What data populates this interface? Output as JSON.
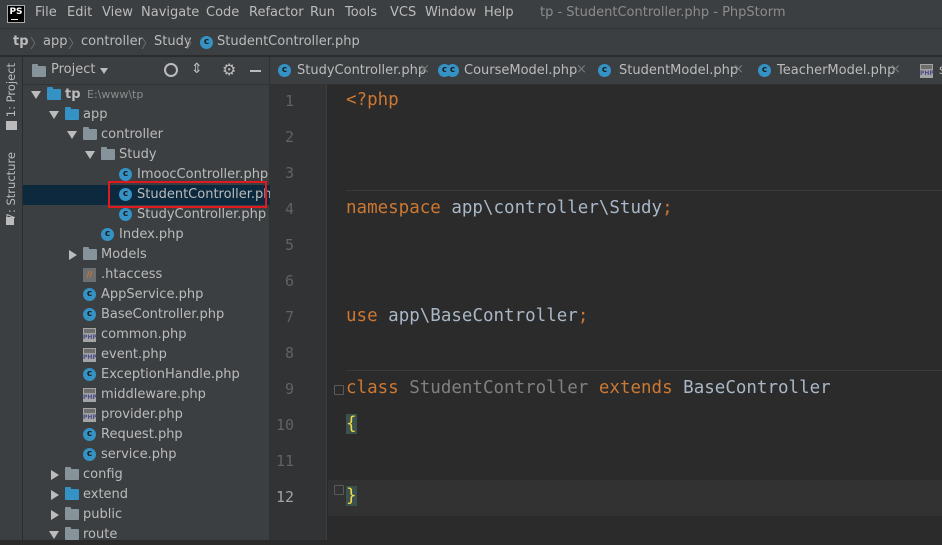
{
  "window": {
    "title": "tp - StudentController.php - PhpStorm",
    "logo_text": "PS"
  },
  "menu": [
    "File",
    "Edit",
    "View",
    "Navigate",
    "Code",
    "Refactor",
    "Run",
    "Tools",
    "VCS",
    "Window",
    "Help"
  ],
  "breadcrumbs": [
    "tp",
    "app",
    "controller",
    "Study",
    "StudentController.php"
  ],
  "sidestrip": {
    "project_tab": "1: Project",
    "structure_tab": "7: Structure"
  },
  "project_panel": {
    "title": "Project",
    "tree": [
      {
        "label": "tp",
        "extra": "E:\\www\\tp",
        "type": "folder-blue",
        "depth": 0,
        "expanded": true,
        "bold": true
      },
      {
        "label": "app",
        "type": "folder-blue",
        "depth": 1,
        "expanded": true
      },
      {
        "label": "controller",
        "type": "folder",
        "depth": 2,
        "expanded": true
      },
      {
        "label": "Study",
        "type": "folder",
        "depth": 3,
        "expanded": true
      },
      {
        "label": "ImoocController.php",
        "type": "class",
        "depth": 4
      },
      {
        "label": "StudentController.php",
        "type": "class",
        "depth": 4,
        "selected": true,
        "highlighted": true
      },
      {
        "label": "StudyController.php",
        "type": "class",
        "depth": 4
      },
      {
        "label": "Index.php",
        "type": "class",
        "depth": 3
      },
      {
        "label": "Models",
        "type": "folder",
        "depth": 2,
        "expanded": false
      },
      {
        "label": ".htaccess",
        "type": "htaccess",
        "depth": 2
      },
      {
        "label": "AppService.php",
        "type": "class",
        "depth": 2
      },
      {
        "label": "BaseController.php",
        "type": "class",
        "depth": 2
      },
      {
        "label": "common.php",
        "type": "php",
        "depth": 2
      },
      {
        "label": "event.php",
        "type": "php",
        "depth": 2
      },
      {
        "label": "ExceptionHandle.php",
        "type": "class",
        "depth": 2
      },
      {
        "label": "middleware.php",
        "type": "php",
        "depth": 2
      },
      {
        "label": "provider.php",
        "type": "php",
        "depth": 2
      },
      {
        "label": "Request.php",
        "type": "class",
        "depth": 2
      },
      {
        "label": "service.php",
        "type": "class",
        "depth": 2
      },
      {
        "label": "config",
        "type": "folder",
        "depth": 1,
        "expanded": false
      },
      {
        "label": "extend",
        "type": "folder-blue",
        "depth": 1,
        "expanded": false
      },
      {
        "label": "public",
        "type": "folder",
        "depth": 1,
        "expanded": false
      },
      {
        "label": "route",
        "type": "folder",
        "depth": 1,
        "expanded": true
      }
    ]
  },
  "tabs": [
    {
      "label": "StudyController.php"
    },
    {
      "label": "CourseModel.php"
    },
    {
      "label": "StudentModel.php"
    },
    {
      "label": "TeacherModel.php"
    },
    {
      "label": "s"
    }
  ],
  "editor": {
    "current_line": 12,
    "lines": [
      {
        "n": "1",
        "tokens": [
          [
            "kw",
            "<?php"
          ]
        ]
      },
      {
        "n": "2",
        "tokens": []
      },
      {
        "n": "3",
        "tokens": []
      },
      {
        "n": "4",
        "tokens": [
          [
            "kw",
            "namespace "
          ],
          [
            "txt",
            "app\\controller\\Study"
          ],
          [
            "kw",
            ";"
          ]
        ]
      },
      {
        "n": "5",
        "tokens": []
      },
      {
        "n": "6",
        "tokens": []
      },
      {
        "n": "7",
        "tokens": [
          [
            "kw",
            "use "
          ],
          [
            "txt",
            "app\\BaseController"
          ],
          [
            "kw",
            ";"
          ]
        ]
      },
      {
        "n": "8",
        "tokens": []
      },
      {
        "n": "9",
        "tokens": [
          [
            "kw",
            "class "
          ],
          [
            "cls-dim",
            "StudentController "
          ],
          [
            "kw",
            "extends "
          ],
          [
            "txt",
            "BaseController"
          ]
        ]
      },
      {
        "n": "10",
        "tokens": [
          [
            "brace",
            "{"
          ]
        ]
      },
      {
        "n": "11",
        "tokens": []
      },
      {
        "n": "12",
        "tokens": [
          [
            "brace",
            "}"
          ]
        ]
      }
    ]
  }
}
